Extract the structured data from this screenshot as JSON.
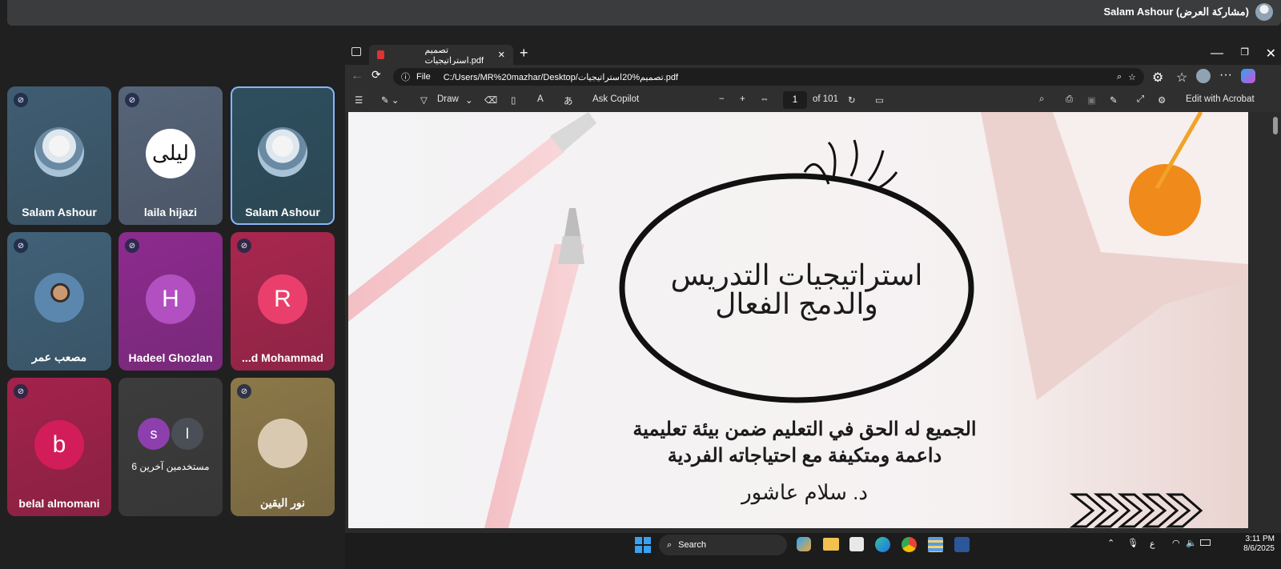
{
  "meet": {
    "presenter_label": "Salam Ashour (مشاركة العرض)",
    "tiles": [
      {
        "name": "Salam Ashour",
        "kind": "photo-hijab",
        "mic": "muted",
        "bg": "#3f5d72"
      },
      {
        "name": "laila hijazi",
        "kind": "logo",
        "logo_text": "ليلى",
        "mic": "muted",
        "bg": "#566479"
      },
      {
        "name": "Salam Ashour",
        "kind": "photo-hijab",
        "mic": "none",
        "bg": "#2e4f5f"
      },
      {
        "name": "مصعب عمر",
        "kind": "photo-man",
        "mic": "muted",
        "bg": "#406178"
      },
      {
        "name": "Hadeel Ghozlan",
        "kind": "letter",
        "letter": "H",
        "mic": "muted",
        "bg": "#8d2b8f"
      },
      {
        "name": "...d Mohammad",
        "kind": "letter",
        "letter": "R",
        "mic": "muted",
        "bg": "#a9264f"
      },
      {
        "name": "belal almomani",
        "kind": "letter",
        "letter": "b",
        "mic": "muted",
        "bg": "#a3224b"
      },
      {
        "name": "6 مستخدمين آخرين",
        "kind": "others",
        "letters": [
          "s",
          "l"
        ],
        "mic": "none",
        "bg": "#3c3c3c"
      },
      {
        "name": "نور اليقين",
        "kind": "photo-note",
        "mic": "muted",
        "bg": "#8c7848"
      }
    ]
  },
  "browser": {
    "tab_title": "تصميم استراتيجيات.pdf",
    "file_label": "File",
    "url": "C:/Users/MR%20mazhar/Desktop/تصميم%20استراتيجيات.pdf",
    "toolbar": {
      "draw": "Draw",
      "ask_copilot": "Ask Copilot",
      "page": "1",
      "of_pages": "of 101",
      "edit_acrobat": "Edit with Acrobat"
    }
  },
  "slide": {
    "title_line1": "استراتيجيات التدريس",
    "title_line2": "والدمج الفعال",
    "subtitle_line1": "الجميع له الحق في التعليم ضمن بيئة تعليمية",
    "subtitle_line2": "داعمة ومتكيفة مع احتياجاته الفردية",
    "author": "د. سلام عاشور"
  },
  "taskbar": {
    "search": "Search",
    "time": "3:11 PM",
    "date": "8/6/2025",
    "lang": "ع"
  }
}
